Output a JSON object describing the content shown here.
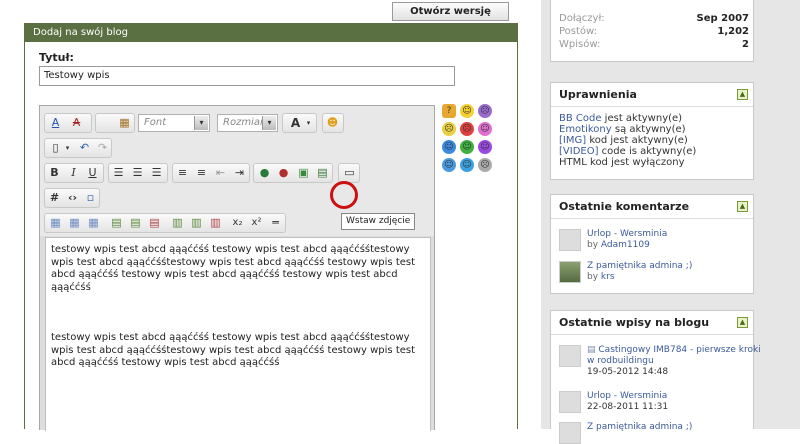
{
  "header": {
    "draft_button": "Otwórz wersję roboczą"
  },
  "panel": {
    "title": "Dodaj na swój blog",
    "title_label": "Tytuł:",
    "title_value": "Testowy wpis"
  },
  "toolbar": {
    "font_placeholder": "Font",
    "size_placeholder": "Rozmiar",
    "tooltip": "Wstaw zdjęcie"
  },
  "editor": {
    "paragraph1": "testowy wpis test abcd ąąąććśś testowy wpis test abcd ąąąććśśtestowy wpis test abcd ąąąććśśtestowy wpis test abcd ąąąććśś testowy wpis test abcd ąąąććśś testowy wpis test abcd ąąąććśś testowy wpis test abcd ąąąććśś",
    "paragraph2": "testowy wpis test abcd ąąąććśś testowy wpis test abcd ąąąććśśtestowy wpis test abcd ąąąććśśtestowy wpis test abcd ąąąććśś testowy wpis test abcd ąąąććśś testowy wpis test abcd ąąąććśś"
  },
  "sidebar": {
    "stats": [
      {
        "label": "Dołączył:",
        "value": "Sep 2007"
      },
      {
        "label": "Postów:",
        "value": "1,202"
      },
      {
        "label": "Wpisów:",
        "value": "2"
      }
    ],
    "permissions": {
      "title": "Uprawnienia",
      "lines": [
        {
          "link": "BB Code",
          "rest": " jest aktywny(e)"
        },
        {
          "link": "Emotikony",
          "rest": " są aktywny(e)"
        },
        {
          "link": "[IMG]",
          "rest": " kod jest aktywny(e)"
        },
        {
          "link": "[VIDEO]",
          "rest": " code is aktywny(e)"
        },
        {
          "link": "",
          "rest": "HTML kod jest wyłączony"
        }
      ]
    },
    "comments": {
      "title": "Ostatnie komentarze",
      "items": [
        {
          "title": "Urlop - Wersminia",
          "by_label": "by",
          "author": "Adam1109"
        },
        {
          "title": "Z pamiętnika admina ;)",
          "by_label": "by",
          "author": "krs"
        }
      ]
    },
    "recent": {
      "title": "Ostatnie wpisy na blogu",
      "items": [
        {
          "title": "Castingowy IMB784 - pierwsze kroki",
          "title2": "w rodbuildingu",
          "date": "19-05-2012 14:48"
        },
        {
          "title": "Urlop - Wersminia",
          "title2": "",
          "date": "22-08-2011 11:31"
        },
        {
          "title": "Z pamiętnika admina ;)",
          "title2": "",
          "date": ""
        }
      ]
    }
  }
}
